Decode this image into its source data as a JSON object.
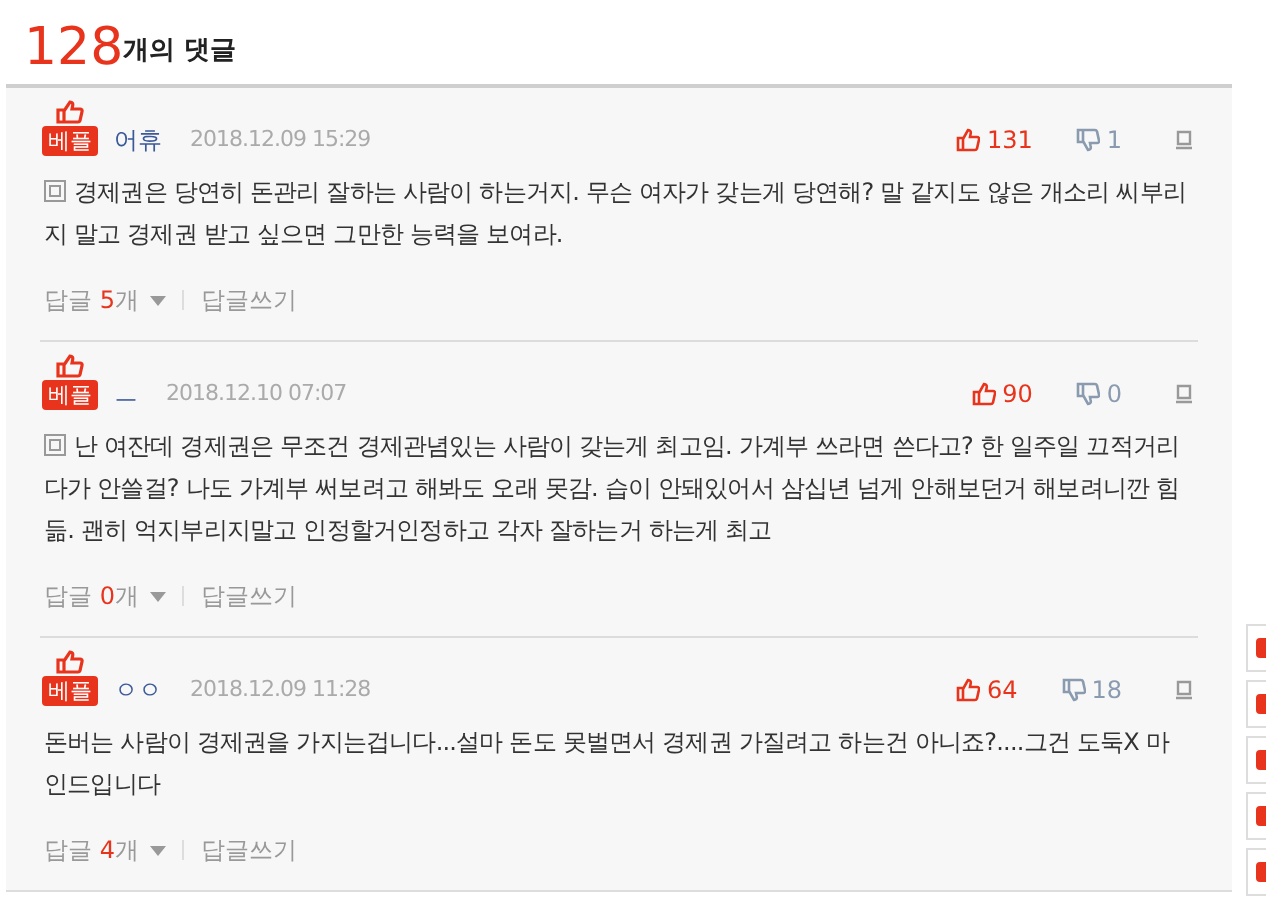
{
  "header": {
    "count": "128",
    "label": "개의 댓글"
  },
  "comments": [
    {
      "badge": "베플",
      "name": "어휴",
      "date": "2018.12.09 15:29",
      "likes": "131",
      "dislikes": "1",
      "has_note_icon": true,
      "body": "경제권은 당연히 돈관리 잘하는 사람이 하는거지. 무슨 여자가 갖는게 당연해? 말 같지도 않은 개소리 씨부리지 말고 경제권 받고 싶으면 그만한 능력을 보여라.",
      "reply_label": "답글",
      "reply_count": "5",
      "reply_unit": "개",
      "write_reply": "답글쓰기"
    },
    {
      "badge": "베플",
      "name": "ㅡ",
      "date": "2018.12.10 07:07",
      "likes": "90",
      "dislikes": "0",
      "has_note_icon": true,
      "body": "난 여잔데 경제권은 무조건 경제관념있는 사람이 갖는게 최고임. 가계부 쓰라면 쓴다고? 한 일주일 끄적거리다가 안쓸걸? 나도 가계부 써보려고 해봐도 오래 못감. 습이 안돼있어서 삼십년 넘게 안해보던거 해보려니깐 힘듦. 괜히 억지부리지말고 인정할거인정하고 각자 잘하는거 하는게 최고",
      "reply_label": "답글",
      "reply_count": "0",
      "reply_unit": "개",
      "write_reply": "답글쓰기"
    },
    {
      "badge": "베플",
      "name": "ㅇㅇ",
      "date": "2018.12.09 11:28",
      "likes": "64",
      "dislikes": "18",
      "has_note_icon": false,
      "body": "돈버는 사람이 경제권을 가지는겁니다...설마 돈도 못벌면서 경제권 가질려고 하는건 아니죠?....그건 도둑X 마인드입니다",
      "reply_label": "답글",
      "reply_count": "4",
      "reply_unit": "개",
      "write_reply": "답글쓰기"
    }
  ]
}
